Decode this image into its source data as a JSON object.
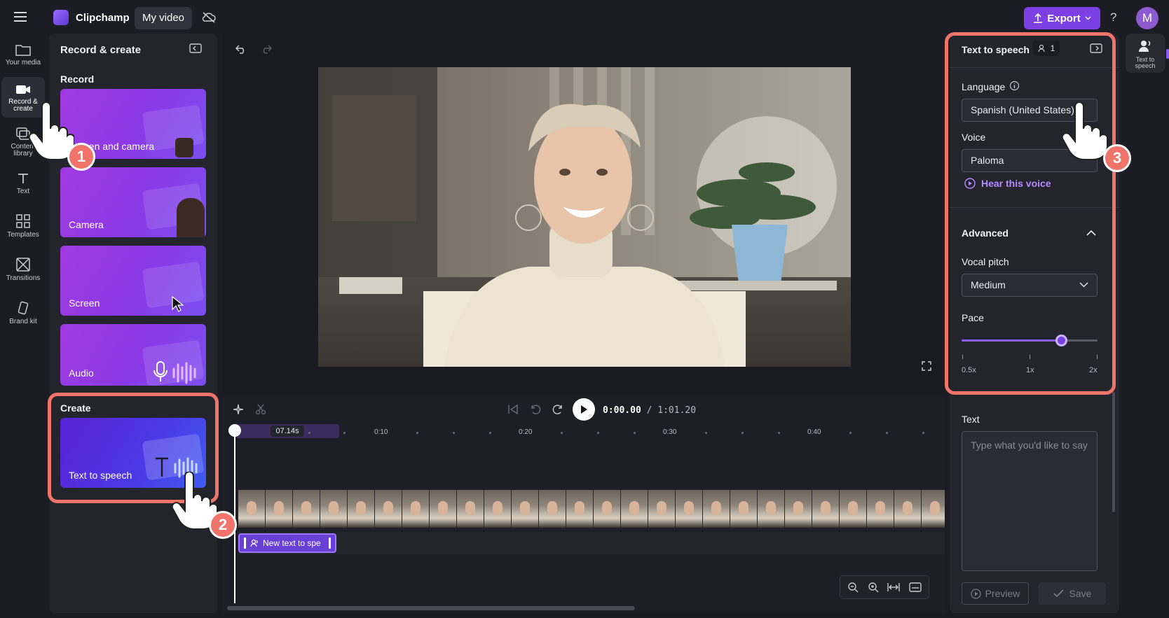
{
  "app": {
    "name": "Clipchamp",
    "project_title": "My video",
    "export_label": "Export",
    "help_label": "?",
    "avatar_initial": "M"
  },
  "nav": {
    "items": [
      {
        "label": "Your media",
        "icon": "folder-icon"
      },
      {
        "label": "Record & create",
        "icon": "video-camera-icon"
      },
      {
        "label": "Content library",
        "icon": "library-icon"
      },
      {
        "label": "Text",
        "icon": "text-icon"
      },
      {
        "label": "Templates",
        "icon": "templates-icon"
      },
      {
        "label": "Transitions",
        "icon": "transitions-icon"
      },
      {
        "label": "Brand kit",
        "icon": "brand-kit-icon"
      }
    ]
  },
  "left_panel": {
    "title": "Record & create",
    "record_label": "Record",
    "cards": [
      "Screen and camera",
      "Camera",
      "Screen",
      "Audio"
    ],
    "create_label": "Create",
    "create_card": "Text to speech"
  },
  "player": {
    "time_current": "0:00.00",
    "time_total": "/ 1:01.20"
  },
  "timeline": {
    "playhead_label": "07.14s",
    "ticks": [
      "0:10",
      "0:20",
      "0:30",
      "0:40"
    ],
    "clip_label": "New text to spe"
  },
  "right_panel": {
    "title": "Text to speech",
    "count": "1",
    "language_label": "Language",
    "language_value": "Spanish (United States)",
    "voice_label": "Voice",
    "voice_value": "Paloma",
    "hear_voice": "Hear this voice",
    "advanced_label": "Advanced",
    "pitch_label": "Vocal pitch",
    "pitch_value": "Medium",
    "pace_label": "Pace",
    "pace_ticks": [
      "0.5x",
      "1x",
      "2x"
    ],
    "pace_value": 0.73,
    "text_label": "Text",
    "text_placeholder": "Type what you'd like to say",
    "preview_label": "Preview",
    "save_label": "Save"
  },
  "right_rail": {
    "label": "Text to speech"
  },
  "annotations": {
    "step1": "1",
    "step2": "2",
    "step3": "3"
  },
  "colors": {
    "accent": "#7b3fe4",
    "highlight": "#f0746a",
    "link": "#b58bff"
  }
}
